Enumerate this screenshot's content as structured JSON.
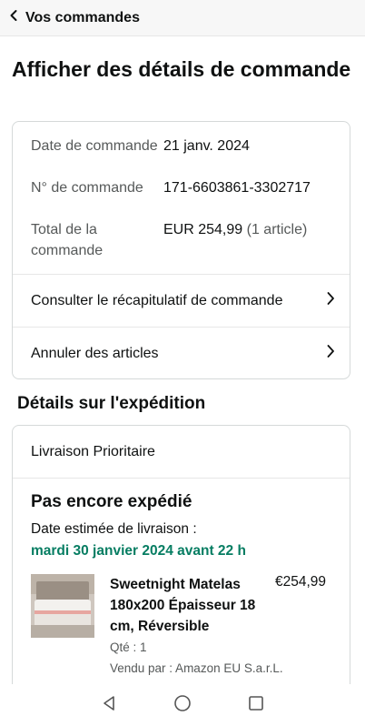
{
  "header": {
    "back_label": "Vos commandes"
  },
  "page_title": "Afficher des détails de commande",
  "order_info": {
    "rows": [
      {
        "label": "Date de commande",
        "value": "21 janv. 2024",
        "extra": ""
      },
      {
        "label": "N° de commande",
        "value": "171-6603861-3302717",
        "extra": ""
      },
      {
        "label": "Total de la commande",
        "value": "EUR 254,99",
        "extra": "(1 article)"
      }
    ],
    "links": [
      {
        "label": "Consulter le récapitulatif de commande"
      },
      {
        "label": "Annuler des articles"
      }
    ]
  },
  "shipping": {
    "section_title": "Détails sur l'expédition",
    "delivery_type": "Livraison Prioritaire",
    "status": "Pas encore expédié",
    "estimate_label": "Date estimée de livraison :",
    "estimate_date": "mardi 30 janvier 2024 avant 22 h",
    "product": {
      "name": "Sweetnight Matelas 180x200 Épaisseur 18 cm, Réversible",
      "price": "€254,99",
      "qty": "Qté : 1",
      "seller": "Vendu par : Amazon EU S.a.r.L."
    }
  },
  "navbar": {
    "icons": [
      "back-triangle-icon",
      "home-circle-icon",
      "recents-square-icon"
    ]
  },
  "colors": {
    "accent_green": "#067d62",
    "text": "#0f1111",
    "muted": "#565959",
    "border": "#d5d9d9"
  }
}
